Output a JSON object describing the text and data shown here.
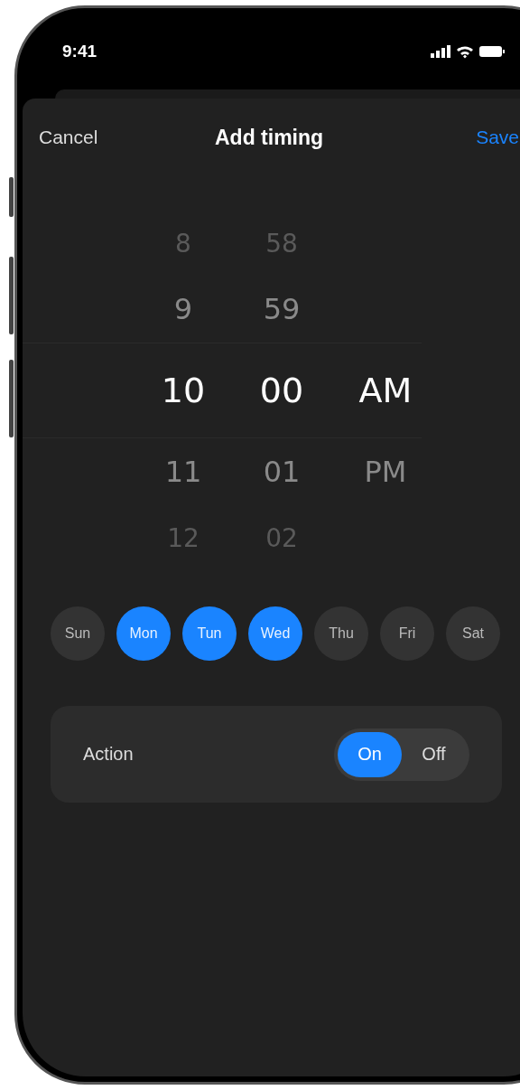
{
  "status_bar": {
    "time": "9:41"
  },
  "nav": {
    "cancel": "Cancel",
    "title": "Add timing",
    "save": "Save"
  },
  "picker": {
    "columns": [
      {
        "items": [
          {
            "label": "8",
            "selected": false
          },
          {
            "label": "9",
            "selected": false
          },
          {
            "label": "10",
            "selected": true
          },
          {
            "label": "11",
            "selected": false
          },
          {
            "label": "12",
            "selected": false
          }
        ]
      },
      {
        "items": [
          {
            "label": "58",
            "selected": false
          },
          {
            "label": "59",
            "selected": false
          },
          {
            "label": "00",
            "selected": true
          },
          {
            "label": "01",
            "selected": false
          },
          {
            "label": "02",
            "selected": false
          }
        ]
      },
      {
        "items": [
          {
            "label": "AM",
            "selected": true
          },
          {
            "label": "PM",
            "selected": false
          }
        ]
      }
    ]
  },
  "days": [
    {
      "label": "Sun",
      "selected": false
    },
    {
      "label": "Mon",
      "selected": true
    },
    {
      "label": "Tun",
      "selected": true
    },
    {
      "label": "Wed",
      "selected": true
    },
    {
      "label": "Thu",
      "selected": false
    },
    {
      "label": "Fri",
      "selected": false
    },
    {
      "label": "Sat",
      "selected": false
    }
  ],
  "action": {
    "label": "Action",
    "options": [
      {
        "label": "On",
        "selected": true
      },
      {
        "label": "Off",
        "selected": false
      }
    ]
  }
}
